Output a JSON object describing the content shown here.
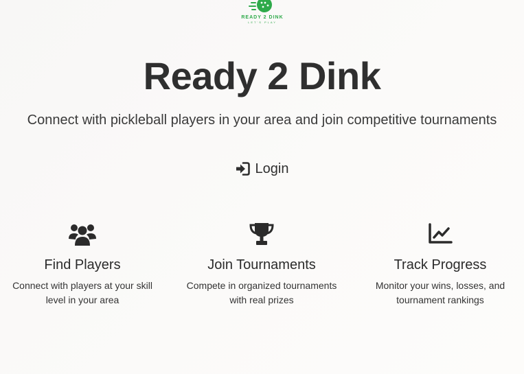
{
  "logo": {
    "title": "READY 2 DINK",
    "tagline": "LET'S PLAY",
    "color": "#2eaa4a"
  },
  "hero": {
    "title": "Ready 2 Dink",
    "subtitle": "Connect with pickleball players in your area and join competitive tournaments"
  },
  "login": {
    "label": "Login",
    "icon": "sign-in-icon"
  },
  "features": [
    {
      "icon": "users-icon",
      "title": "Find Players",
      "description": "Connect with players at your skill level in your area"
    },
    {
      "icon": "trophy-icon",
      "title": "Join Tournaments",
      "description": "Compete in organized tournaments with real prizes"
    },
    {
      "icon": "line-chart-icon",
      "title": "Track Progress",
      "description": "Monitor your wins, losses, and tournament rankings"
    }
  ]
}
